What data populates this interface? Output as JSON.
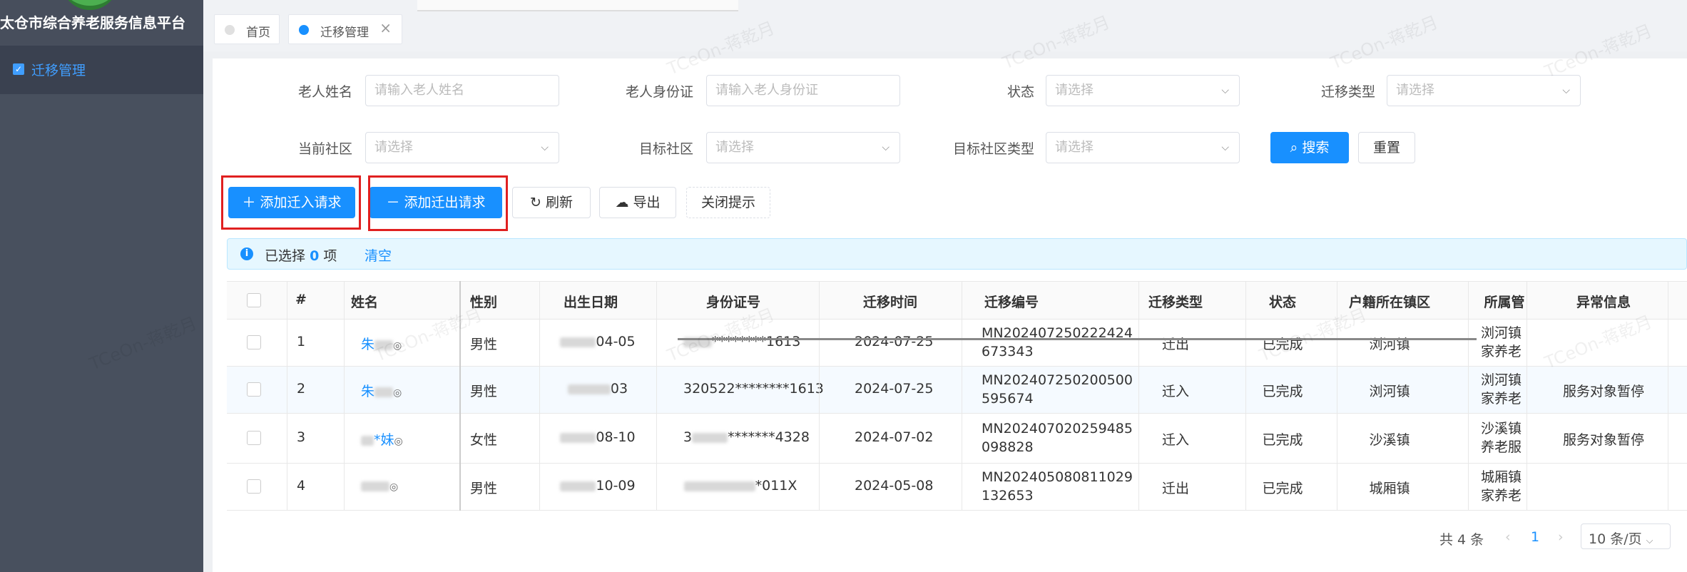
{
  "app": {
    "title": "太仓市综合养老服务信息平台"
  },
  "sidebar": {
    "items": [
      {
        "label": "迁移管理",
        "active": true
      }
    ]
  },
  "tabs": [
    {
      "label": "首页",
      "active": false
    },
    {
      "label": "迁移管理",
      "active": true
    }
  ],
  "filters": {
    "elder_name": {
      "label": "老人姓名",
      "placeholder": "请输入老人姓名"
    },
    "elder_id": {
      "label": "老人身份证",
      "placeholder": "请输入老人身份证"
    },
    "status": {
      "label": "状态",
      "placeholder": "请选择"
    },
    "migration_type": {
      "label": "迁移类型",
      "placeholder": "请选择"
    },
    "current_community": {
      "label": "当前社区",
      "placeholder": "请选择"
    },
    "target_community": {
      "label": "目标社区",
      "placeholder": "请选择"
    },
    "target_community_type": {
      "label": "目标社区类型",
      "placeholder": "请选择"
    },
    "search_label": "搜索",
    "reset_label": "重置"
  },
  "toolbar": {
    "add_in": "添加迁入请求",
    "add_out": "添加迁出请求",
    "refresh": "刷新",
    "export": "导出",
    "close_tip": "关闭提示"
  },
  "selection": {
    "prefix": "已选择",
    "count": "0",
    "suffix": "项",
    "clear": "清空"
  },
  "table": {
    "columns": [
      "#",
      "姓名",
      "性别",
      "出生日期",
      "身份证号",
      "迁移时间",
      "迁移编号",
      "迁移类型",
      "状态",
      "户籍所在镇区",
      "所属管",
      "异常信息"
    ],
    "rows": [
      {
        "no": "1",
        "name_a": "朱",
        "name_b": "",
        "gender": "男性",
        "birth_b": "04-05",
        "id_a": "",
        "id_b": "********1613",
        "time": "2024-07-25",
        "code_1": "MN202407250222424",
        "code_2": "673343",
        "type": "迁出",
        "status": "已完成",
        "town": "浏河镇",
        "org_1": "浏河镇",
        "org_2": "家养老",
        "exception": ""
      },
      {
        "no": "2",
        "name_a": "朱",
        "name_b": "",
        "gender": "男性",
        "birth_b": "03",
        "id_a": "320522",
        "id_b": "********1613",
        "time": "2024-07-25",
        "code_1": "MN202407250200500",
        "code_2": "595674",
        "type": "迁入",
        "status": "已完成",
        "town": "浏河镇",
        "org_1": "浏河镇",
        "org_2": "家养老",
        "exception": "服务对象暂停"
      },
      {
        "no": "3",
        "name_a": "",
        "name_b": "*妹",
        "gender": "女性",
        "birth_b": "08-10",
        "id_a": "3",
        "id_b": "*******4328",
        "time": "2024-07-02",
        "code_1": "MN202407020259485",
        "code_2": "098828",
        "type": "迁入",
        "status": "已完成",
        "town": "沙溪镇",
        "org_1": "沙溪镇",
        "org_2": "养老服",
        "exception": "服务对象暂停"
      },
      {
        "no": "4",
        "name_a": "",
        "name_b": "",
        "gender": "男性",
        "birth_b": "10-09",
        "id_a": "",
        "id_b": "*011X",
        "time": "2024-05-08",
        "code_1": "MN202405080811029",
        "code_2": "132653",
        "type": "迁出",
        "status": "已完成",
        "town": "城厢镇",
        "org_1": "城厢镇",
        "org_2": "家养老",
        "exception": ""
      }
    ]
  },
  "pagination": {
    "total": "共 4 条",
    "current": "1",
    "page_size": "10 条/页"
  },
  "watermark": "TCeOn-蒋乾月",
  "colors": {
    "primary": "#1890ff",
    "sidebar": "#48505e",
    "highlight_box": "#e02020"
  }
}
